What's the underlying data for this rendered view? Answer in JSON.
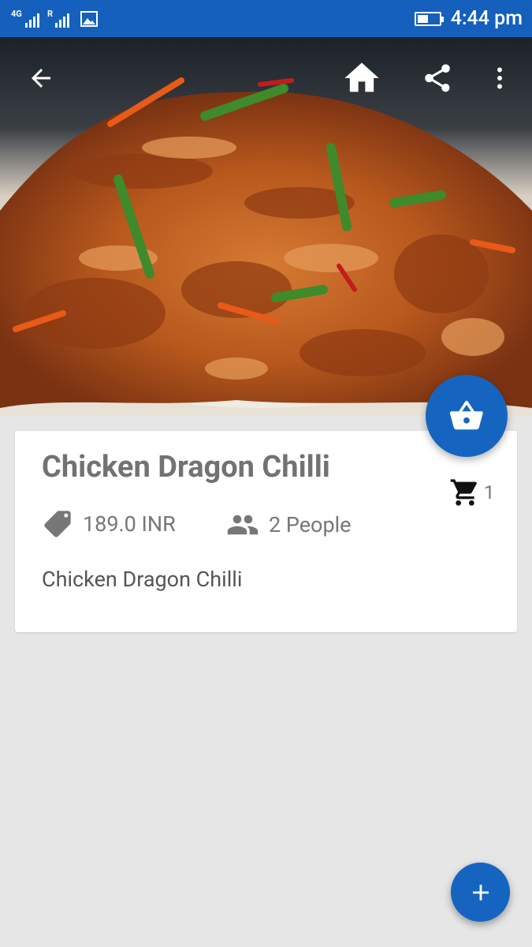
{
  "status_bar": {
    "network": "4G",
    "roaming": "R",
    "time": "4:44 pm",
    "battery_level_pct": 50
  },
  "toolbar": {
    "back_icon": "arrow-left-icon",
    "home_icon": "home-icon",
    "share_icon": "share-icon",
    "overflow_icon": "more-vert-icon"
  },
  "product": {
    "name": "Chicken Dragon Chilli",
    "price": "189.0 INR",
    "serves": "2 People",
    "description": "Chicken Dragon Chilli",
    "cart_count": "1"
  },
  "colors": {
    "primary": "#1565c0",
    "status_bar": "#1560bd",
    "background": "#e6e6e6"
  }
}
